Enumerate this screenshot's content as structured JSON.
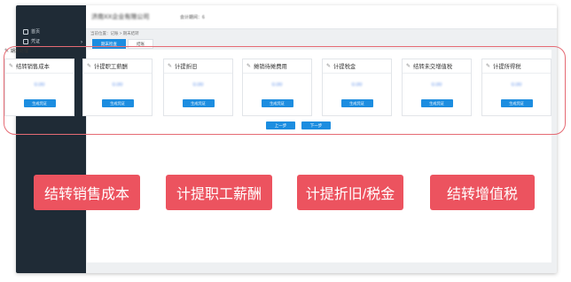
{
  "app": {
    "company_name": "济南XX企业有限公司",
    "period_label": "会计期间：6"
  },
  "sidebar": {
    "items": [
      {
        "label": "首页",
        "icon": "home-icon"
      },
      {
        "label": "凭证",
        "icon": "document-icon"
      }
    ]
  },
  "breadcrumb": "当前位置：记账 > 期末结转",
  "tabs": [
    {
      "label": "期末检查",
      "active": true
    },
    {
      "label": "结账",
      "active": false
    }
  ],
  "section": {
    "title": "期末处理"
  },
  "cards": [
    {
      "title": "结转销售成本",
      "amount": "0.00",
      "button": "生成凭证"
    },
    {
      "title": "计提职工薪酬",
      "amount": "0.00",
      "button": "生成凭证"
    },
    {
      "title": "计提折旧",
      "amount": "0.00",
      "button": "生成凭证"
    },
    {
      "title": "摊销待摊费用",
      "amount": "0.00",
      "button": "生成凭证"
    },
    {
      "title": "计提税金",
      "amount": "0.00",
      "button": "生成凭证"
    },
    {
      "title": "结转未交增值税",
      "amount": "0.00",
      "button": "生成凭证"
    },
    {
      "title": "计提所得税",
      "amount": "0.00",
      "button": "生成凭证"
    }
  ],
  "navigation": {
    "prev": "上一步",
    "next": "下一步"
  },
  "annotations": [
    "结转销售成本",
    "计提职工薪酬",
    "计提折旧/税金",
    "结转增值税"
  ],
  "colors": {
    "primary": "#1c8de0",
    "sidebar": "#1f2b36",
    "highlight": "#e56b74",
    "tag": "#ec535f"
  }
}
